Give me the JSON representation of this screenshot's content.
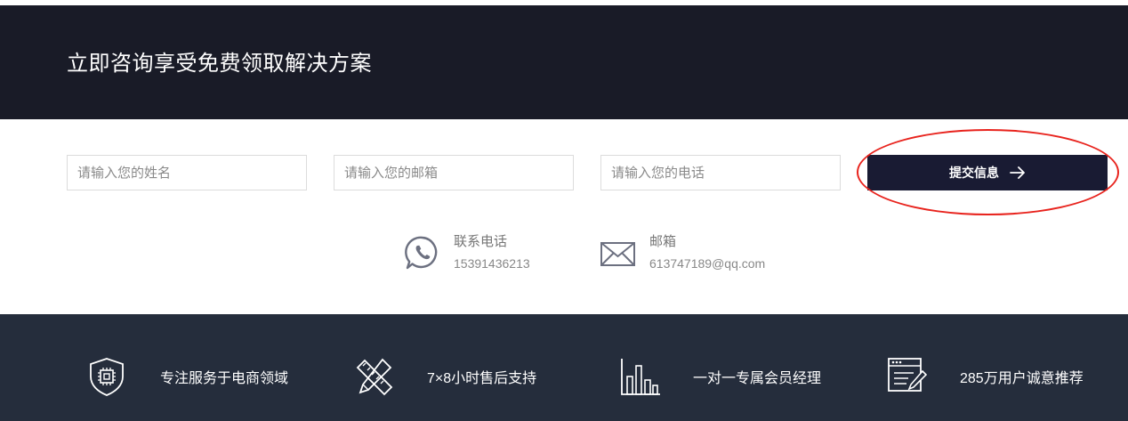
{
  "banner": {
    "title": "立即咨询享受免费领取解决方案"
  },
  "form": {
    "name_placeholder": "请输入您的姓名",
    "email_placeholder": "请输入您的邮箱",
    "phone_placeholder": "请输入您的电话",
    "submit_label": "提交信息"
  },
  "contacts": [
    {
      "icon": "whatsapp-phone-icon",
      "label": "联系电话",
      "value": "15391436213"
    },
    {
      "icon": "mail-icon",
      "label": "邮箱",
      "value": "613747189@qq.com"
    }
  ],
  "features": [
    {
      "icon": "shield-chip-icon",
      "text": "专注服务于电商领域"
    },
    {
      "icon": "tools-icon",
      "text": "7×8小时售后支持"
    },
    {
      "icon": "bar-chart-icon",
      "text": "一对一专属会员经理"
    },
    {
      "icon": "browser-edit-icon",
      "text": "285万用户诚意推荐"
    }
  ],
  "colors": {
    "banner_bg": "#191b27",
    "submit_bg": "#191b33",
    "features_bg": "#252d3c",
    "highlight": "#e8231d"
  }
}
